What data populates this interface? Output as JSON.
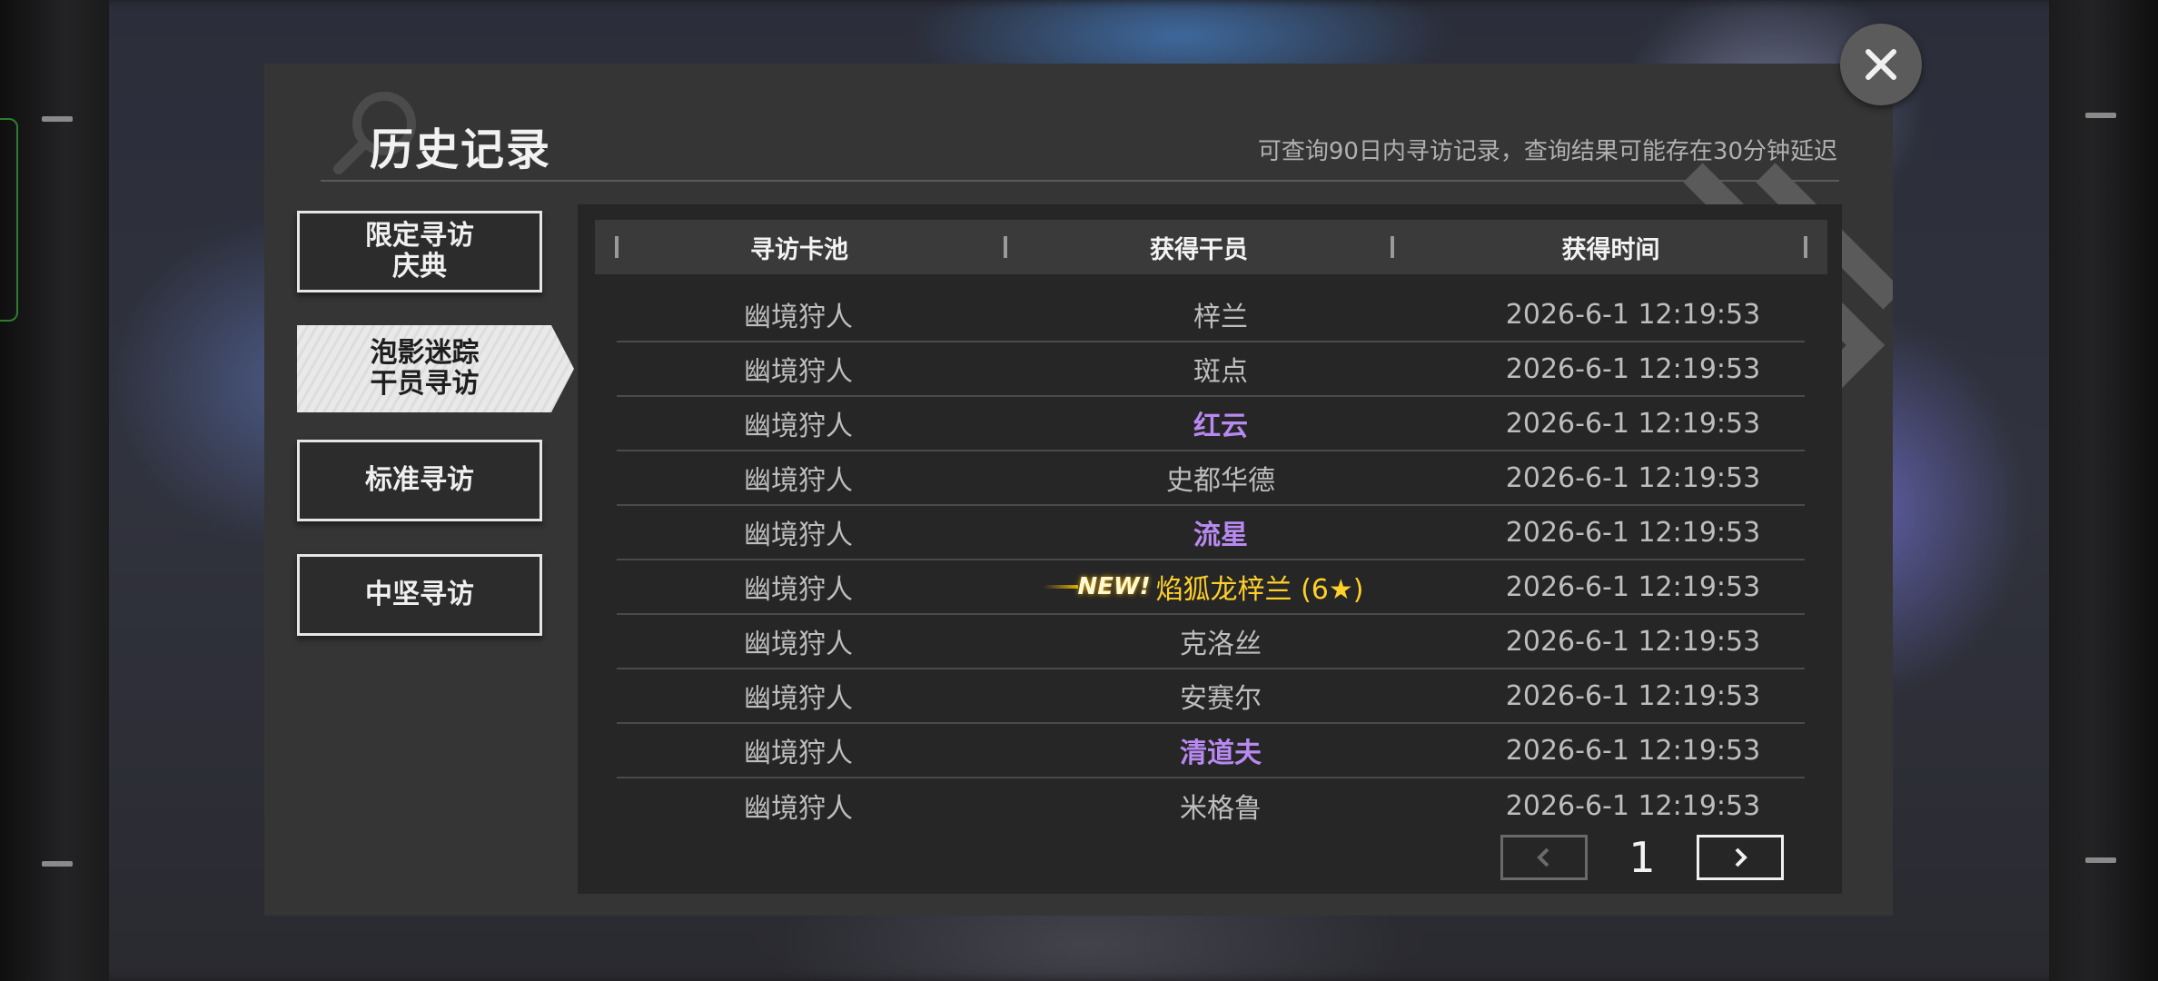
{
  "dialog": {
    "title": "历史记录",
    "notice": "可查询90日内寻访记录，查询结果可能存在30分钟延迟"
  },
  "tabs": [
    {
      "label": "限定寻访\n庆典",
      "active": false
    },
    {
      "label": "泡影迷踪\n干员寻访",
      "active": true
    },
    {
      "label": "标准寻访",
      "active": false
    },
    {
      "label": "中坚寻访",
      "active": false
    }
  ],
  "table": {
    "headers": [
      "寻访卡池",
      "获得干员",
      "获得时间"
    ],
    "rows": [
      {
        "pool": "幽境狩人",
        "operator": "梓兰",
        "time": "2026-6-1 12:19:53",
        "rarity": "normal"
      },
      {
        "pool": "幽境狩人",
        "operator": "斑点",
        "time": "2026-6-1 12:19:53",
        "rarity": "normal"
      },
      {
        "pool": "幽境狩人",
        "operator": "红云",
        "time": "2026-6-1 12:19:53",
        "rarity": "purple"
      },
      {
        "pool": "幽境狩人",
        "operator": "史都华德",
        "time": "2026-6-1 12:19:53",
        "rarity": "normal"
      },
      {
        "pool": "幽境狩人",
        "operator": "流星",
        "time": "2026-6-1 12:19:53",
        "rarity": "purple"
      },
      {
        "pool": "幽境狩人",
        "operator": "焰狐龙梓兰 (6★)",
        "time": "2026-6-1 12:19:53",
        "rarity": "gold",
        "badge": "NEW!"
      },
      {
        "pool": "幽境狩人",
        "operator": "克洛丝",
        "time": "2026-6-1 12:19:53",
        "rarity": "normal"
      },
      {
        "pool": "幽境狩人",
        "operator": "安赛尔",
        "time": "2026-6-1 12:19:53",
        "rarity": "normal"
      },
      {
        "pool": "幽境狩人",
        "operator": "清道夫",
        "time": "2026-6-1 12:19:53",
        "rarity": "purple"
      },
      {
        "pool": "幽境狩人",
        "operator": "米格鲁",
        "time": "2026-6-1 12:19:53",
        "rarity": "normal"
      }
    ]
  },
  "pager": {
    "current_page": "1",
    "prev_icon": "chevron-left-icon",
    "next_icon": "chevron-right-icon"
  },
  "close_icon": "close-icon",
  "colors": {
    "purple": "#b889f0",
    "gold": "#ffd02a",
    "panel": "#353535",
    "table": "#262626"
  }
}
